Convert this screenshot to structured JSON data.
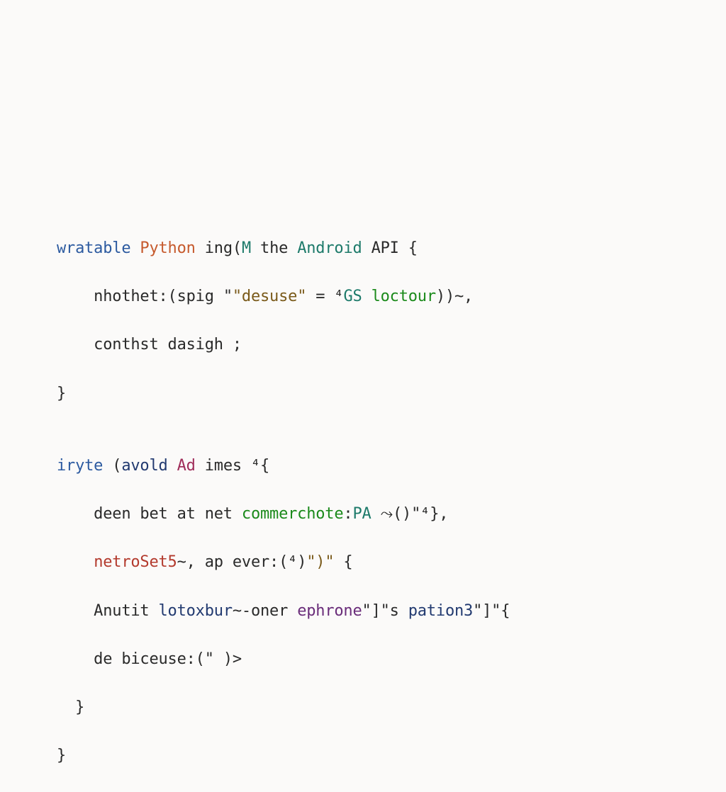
{
  "code": {
    "line1": {
      "t1": "wratable",
      "t2": "Python",
      "t3": "ing",
      "t4": "(",
      "t5": "M",
      "t6": " the ",
      "t7": "Android",
      "t8": " API {"
    },
    "line2": {
      "t1": "    nhothet:",
      "t2": "(",
      "t3": "spig",
      "t4": " \"",
      "t5": "\"desuse\"",
      "t6": " =",
      "t7": " ⁴",
      "t8": "GS",
      "t9": "loctour",
      "t10": ")",
      "t11": ")~,"
    },
    "line3": {
      "t1": "    conthst dasigh ;"
    },
    "line4": {
      "t1": "}"
    },
    "line5": {
      "t1": ""
    },
    "line6": {
      "t1": "iryte",
      "t2": " (",
      "t3": "avold",
      "t4": "Ad",
      "t5": " imes ",
      "t6": "⁴",
      "t7": "{"
    },
    "line7": {
      "t1": "    deen bet at net ",
      "t2": "commerchote",
      "t3": ":",
      "t4": "PA",
      "t5": " ⤳",
      "t6": "()",
      "t7": "\"⁴",
      "t8": "},"
    },
    "line8": {
      "t1": "    ",
      "t2": "netroSet5",
      "t3": "~, ap ever:(",
      "t4": "⁴",
      "t5": ")",
      "t6": "\")\"",
      "t7": " {"
    },
    "line9": {
      "t1": "    Anutit ",
      "t2": "lotoxbur",
      "t3": "~-oner ",
      "t4": "ephrone",
      "t5": "\"]\"",
      "t6": "s ",
      "t7": "pation3",
      "t8": "\"]\"",
      "t9": "{"
    },
    "line10": {
      "t1": "    de biceuse:(",
      "t2": "\" ",
      "t3": ")>"
    },
    "line11": {
      "t1": "  }"
    },
    "line12": {
      "t1": "}"
    }
  }
}
